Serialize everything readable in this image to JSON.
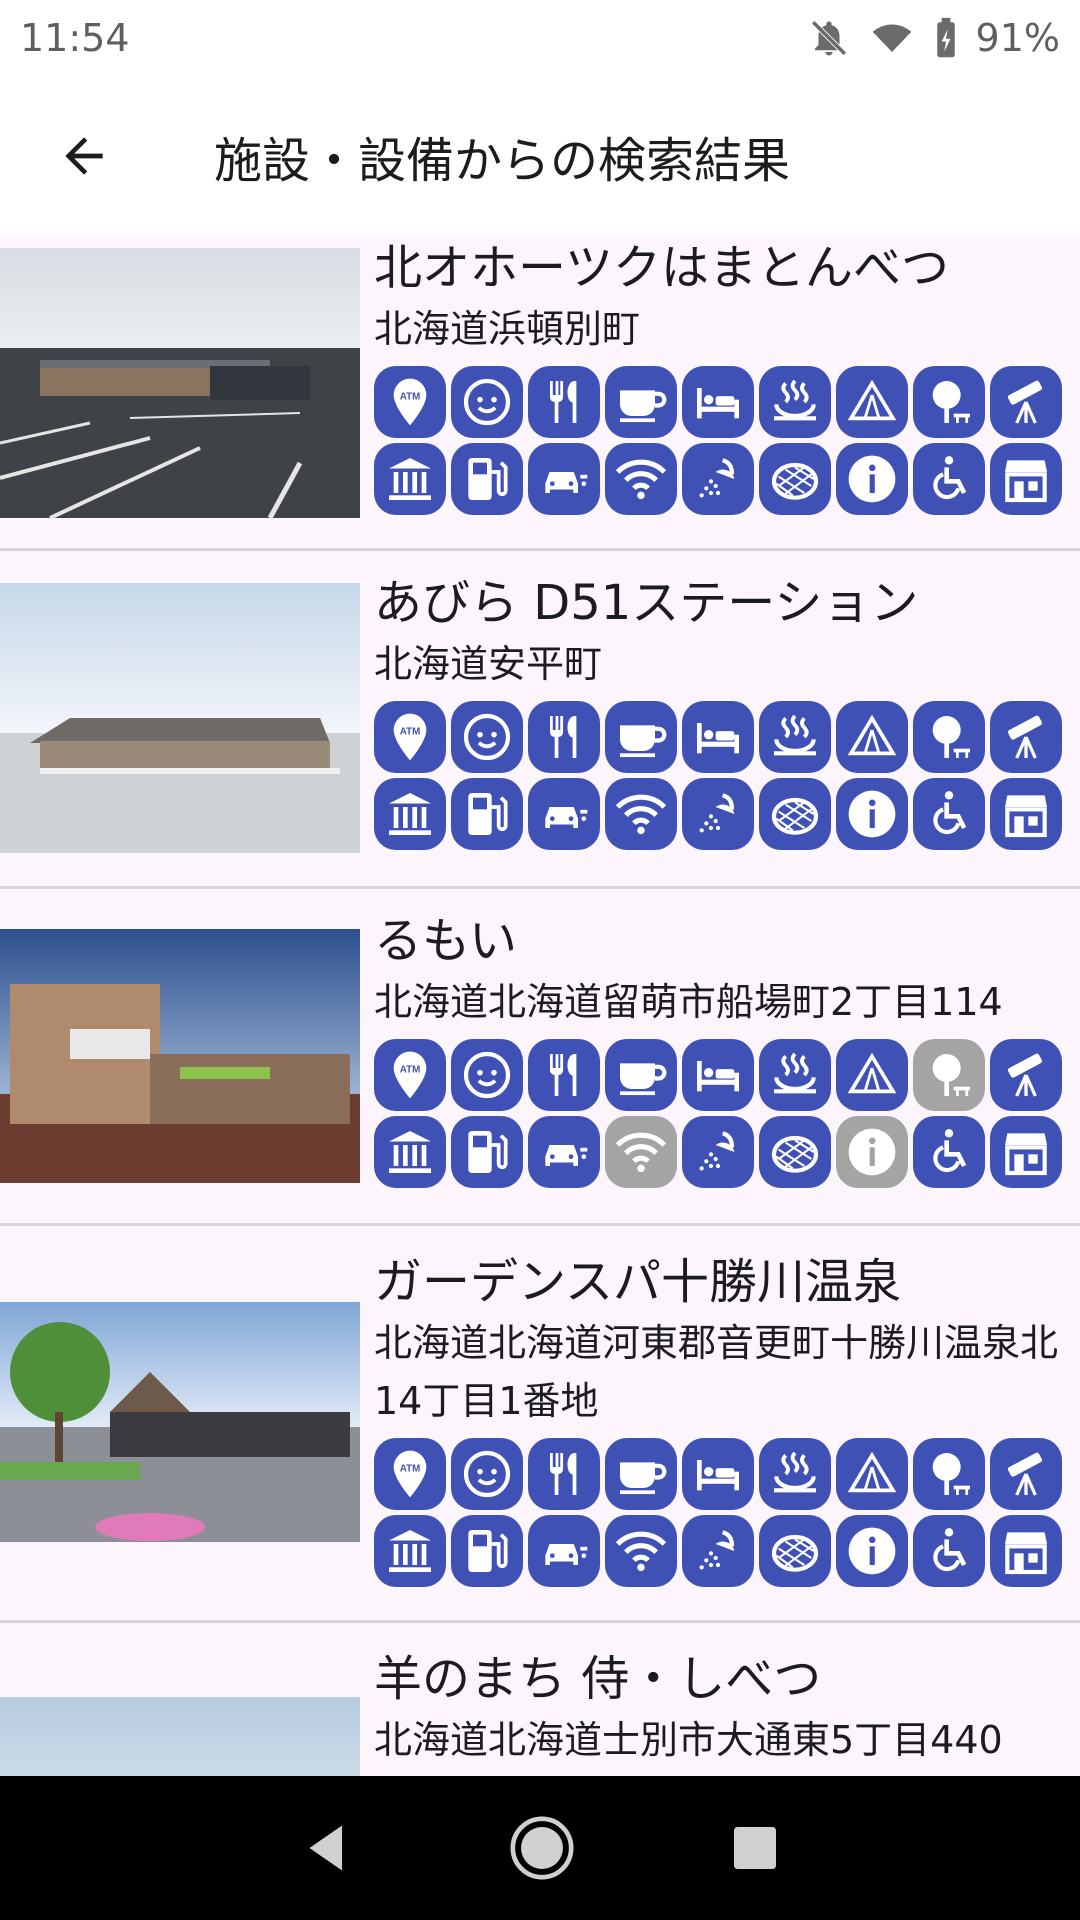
{
  "status": {
    "time": "11:54",
    "battery": "91%"
  },
  "appbar": {
    "title": "施設・設備からの検索結果"
  },
  "facility_icons": [
    "atm-icon",
    "baby-icon",
    "restaurant-icon",
    "cafe-icon",
    "bed-icon",
    "hot-spring-icon",
    "camping-icon",
    "park-icon",
    "telescope-icon",
    "museum-icon",
    "gas-station-icon",
    "ev-charger-icon",
    "wifi-icon",
    "shower-icon",
    "melon-pan-icon",
    "info-icon",
    "wheelchair-icon",
    "store-icon"
  ],
  "results": [
    {
      "name": "北オホーツクはまとんべつ",
      "address": "北海道浜頓別町",
      "unavailable": []
    },
    {
      "name": "あびら D51ステーション",
      "address": "北海道安平町",
      "unavailable": []
    },
    {
      "name": "るもい",
      "address": "北海道北海道留萌市船場町2丁目114",
      "unavailable": [
        "park-icon",
        "wifi-icon",
        "info-icon"
      ]
    },
    {
      "name": "ガーデンスパ十勝川温泉",
      "address": "北海道北海道河東郡音更町十勝川温泉北14丁目1番地",
      "unavailable": []
    },
    {
      "name": "羊のまち 侍・しべつ",
      "address": "北海道北海道士別市大通東5丁目440",
      "unavailable": []
    }
  ],
  "colors": {
    "active": "#3f51b5",
    "inactive": "#a4a4a4",
    "background": "#fdf5fc"
  }
}
